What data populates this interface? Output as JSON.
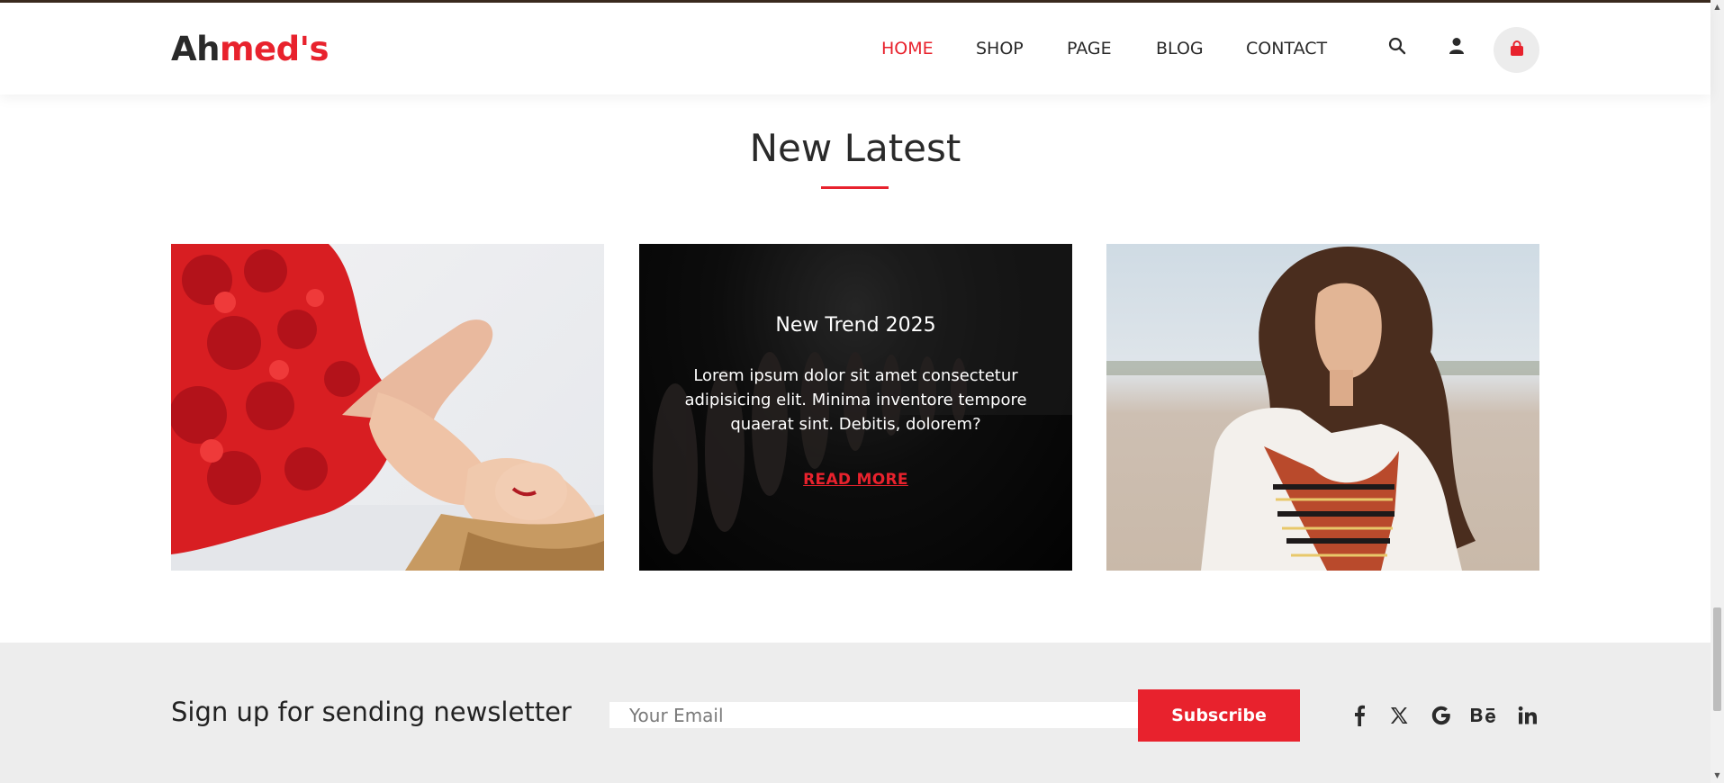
{
  "header": {
    "logo_part1": "Ah",
    "logo_part2": "med's",
    "nav": [
      "HOME",
      "SHOP",
      "PAGE",
      "BLOG",
      "CONTACT"
    ],
    "active_nav": "HOME",
    "icons": [
      "search-icon",
      "user-icon",
      "shopping-bag-icon"
    ]
  },
  "section": {
    "title": "New Latest"
  },
  "cards": [
    {
      "image": "woman in red dress lying on floor"
    },
    {
      "title": "New Trend 2025",
      "body": "Lorem ipsum dolor sit amet consectetur adipisicing elit. Minima inventore tempore quaerat sint. Debitis, dolorem?",
      "link": "READ MORE"
    },
    {
      "image": "woman with curly hair on beach"
    }
  ],
  "newsletter": {
    "heading": "Sign up for sending newsletter",
    "email_placeholder": "Your Email",
    "button": "Subscribe",
    "social": [
      "facebook-icon",
      "x-icon",
      "google-icon",
      "behance-icon",
      "linkedin-icon"
    ]
  },
  "colors": {
    "accent": "#e8222d",
    "text": "#2a2a2a",
    "band": "#ededed"
  }
}
